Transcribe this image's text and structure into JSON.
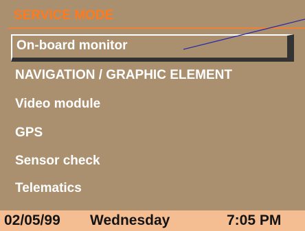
{
  "screen": {
    "title": "SERVICE MODE",
    "colors": {
      "background": "#ab906f",
      "title": "#ff7a1c",
      "rule": "#f08036",
      "text": "#ffffff",
      "status_bar": "#f5bd92",
      "status_text": "#141414",
      "pointer": "#2b2ba6"
    }
  },
  "menu": {
    "selected_index": 0,
    "items": [
      {
        "label": "On-board monitor"
      },
      {
        "label": "NAVIGATION / GRAPHIC ELEMENT"
      },
      {
        "label": "Video module"
      },
      {
        "label": "GPS"
      },
      {
        "label": "Sensor check"
      },
      {
        "label": "Telematics"
      }
    ]
  },
  "status": {
    "date": "02/05/99",
    "day": "Wednesday",
    "time": "7:05 PM"
  }
}
